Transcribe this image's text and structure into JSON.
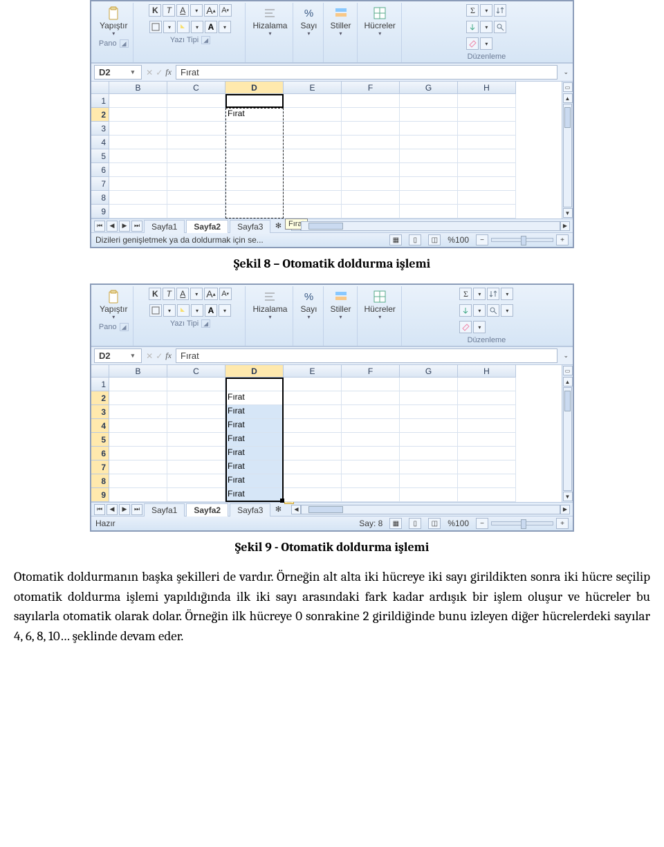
{
  "excel1": {
    "ribbon": {
      "pano_label": "Pano",
      "paste_label": "Yapıştır",
      "font_label": "Yazı Tipi",
      "bold": "K",
      "italic": "T",
      "underline": "A",
      "border_caret": "▾",
      "fill_caret": "▾",
      "grow": "A",
      "shrink": "A",
      "align_label": "Hizalama",
      "number_label": "Sayı",
      "styles_label": "Stiller",
      "cells_label": "Hücreler",
      "edit_label": "Düzenleme"
    },
    "namebox": "D2",
    "formula": "Fırat",
    "columns": [
      "B",
      "C",
      "D",
      "E",
      "F",
      "G",
      "H"
    ],
    "rows": [
      "1",
      "2",
      "3",
      "4",
      "5",
      "6",
      "7",
      "8",
      "9"
    ],
    "cells": {
      "D2": "Fırat"
    },
    "tooltip": "Fırat",
    "tabs": [
      "Sayfa1",
      "Sayfa2",
      "Sayfa3"
    ],
    "active_tab": 1,
    "status": "Dizileri genişletmek ya da doldurmak için se...",
    "zoom": "%100"
  },
  "caption1": "Şekil 8 – Otomatik doldurma işlemi",
  "excel2": {
    "ribbon": {
      "pano_label": "Pano",
      "paste_label": "Yapıştır",
      "font_label": "Yazı Tipi",
      "bold": "K",
      "italic": "T",
      "underline": "A",
      "grow": "A",
      "shrink": "A",
      "align_label": "Hizalama",
      "number_label": "Sayı",
      "styles_label": "Stiller",
      "cells_label": "Hücreler",
      "edit_label": "Düzenleme",
      "percent": "%"
    },
    "namebox": "D2",
    "formula": "Fırat",
    "columns": [
      "B",
      "C",
      "D",
      "E",
      "F",
      "G",
      "H"
    ],
    "rows": [
      "1",
      "2",
      "3",
      "4",
      "5",
      "6",
      "7",
      "8",
      "9"
    ],
    "cells": {
      "D2": "Fırat",
      "D3": "Fırat",
      "D4": "Fırat",
      "D5": "Fırat",
      "D6": "Fırat",
      "D7": "Fırat",
      "D8": "Fırat",
      "D9": "Fırat"
    },
    "tabs": [
      "Sayfa1",
      "Sayfa2",
      "Sayfa3"
    ],
    "active_tab": 1,
    "status": "Hazır",
    "count_label": "Say: 8",
    "zoom": "%100"
  },
  "caption2": "Şekil 9 - Otomatik doldurma işlemi",
  "para1": "Otomatik doldurmanın başka şekilleri de vardır. Örneğin alt alta iki hücreye iki sayı girildikten sonra iki hücre seçilip otomatik doldurma işlemi yapıldığında ilk iki sayı arasındaki fark kadar ardışık bir işlem oluşur ve hücreler bu sayılarla otomatik olarak dolar. Örneğin ilk hücreye 0 sonrakine 2 girildiğinde bunu izleyen diğer hücrelerdeki sayılar 4, 6, 8, 10… şeklinde devam eder."
}
